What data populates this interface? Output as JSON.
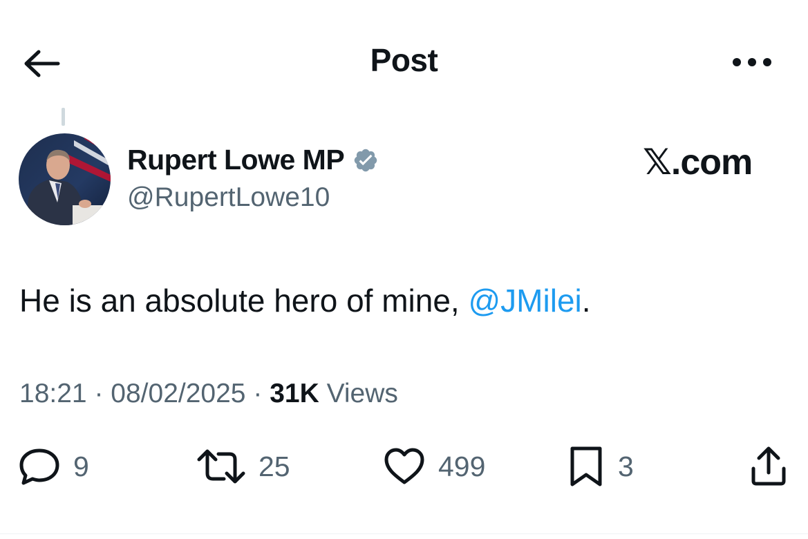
{
  "header": {
    "title": "Post",
    "back_icon": "arrow-left-icon",
    "more_icon": "more-horizontal-icon"
  },
  "author": {
    "display_name": "Rupert Lowe MP",
    "handle": "@RupertLowe10",
    "verified": true,
    "verified_color": "#829aab"
  },
  "watermark": "𝕏.com",
  "tweet": {
    "text_before": "He is an absolute hero of mine, ",
    "mention": "@JMilei",
    "text_after": "."
  },
  "meta": {
    "time": "18:21",
    "date": "08/02/2025",
    "views_count": "31K",
    "views_label": "Views",
    "separator": "·"
  },
  "actions": {
    "replies": "9",
    "reposts": "25",
    "likes": "499",
    "bookmarks": "3"
  },
  "colors": {
    "text": "#0f1419",
    "secondary": "#536471",
    "link": "#1d9bf0"
  }
}
